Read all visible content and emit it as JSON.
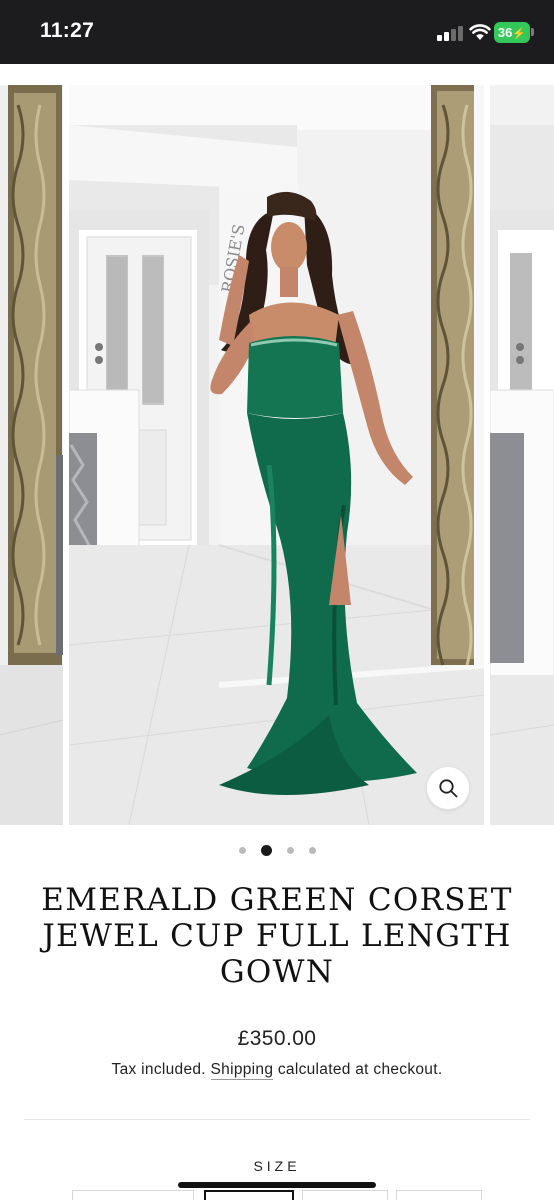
{
  "status_bar": {
    "time": "11:27",
    "battery": "36",
    "icons": [
      "cellular-signal-icon",
      "wifi-icon",
      "battery-charging-icon"
    ]
  },
  "gallery": {
    "current_index": 1,
    "slide_count": 4,
    "image_alt": "Model wearing emerald green satin corset gown",
    "zoom_icon": "magnifier-icon",
    "dress_color": "#0f6b4c"
  },
  "product": {
    "title": "EMERALD GREEN CORSET JEWEL CUP FULL LENGTH GOWN",
    "price": "£350.00",
    "tax_prefix": "Tax included.",
    "tax_link": "Shipping",
    "tax_suffix": "calculated at checkout."
  },
  "size": {
    "label": "SIZE"
  },
  "colors": {
    "status_bar_bg": "#1c1c1e",
    "battery_green": "#34c759",
    "text": "#1a1a1a"
  }
}
